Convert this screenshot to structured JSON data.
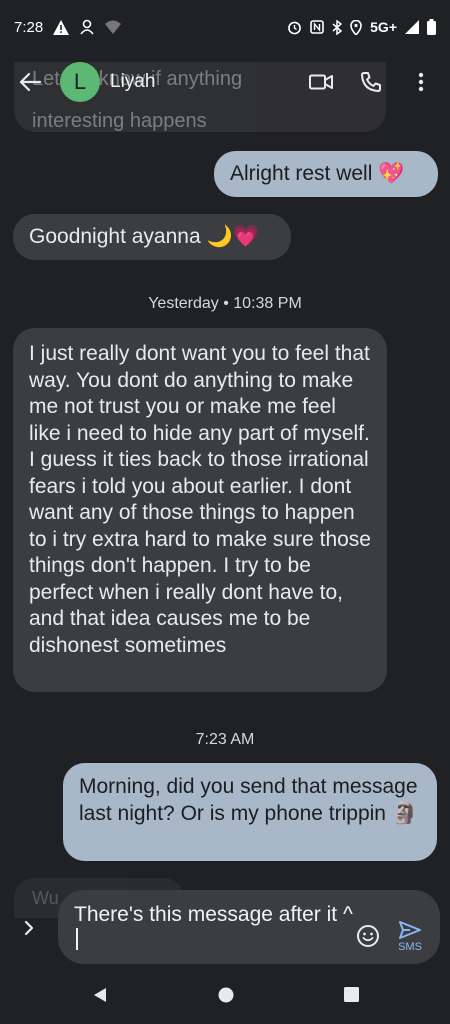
{
  "status_bar": {
    "time": "7:28",
    "network": "5G+"
  },
  "header": {
    "avatar_letter": "L",
    "contact_name": "Liyah"
  },
  "messages": {
    "ghost_top_line1": "Let me know if anything",
    "ghost_top_line2": "interesting happens",
    "m1": "Alright rest well 💖",
    "m2": "Goodnight ayanna 🌙💗",
    "ts1": "Yesterday • 10:38 PM",
    "m3": "I just really dont want you to feel that way. You dont do anything to make me not trust you or make me feel like i need to hide any part of myself. I guess it ties back to those irrational fears i told you about earlier. I dont want any of those things to happen to i try extra hard to make sure those things don't happen. I try to be perfect when i really dont have to, and that idea causes me to be dishonest sometimes",
    "ts2": "7:23 AM",
    "m4": "Morning, did you send that message last night? Or is my phone trippin 🗿",
    "ghost_bottom": "Wu"
  },
  "compose": {
    "text": "There's this message after it ^",
    "send_label": "SMS"
  },
  "colors": {
    "background": "#1f2124",
    "sent_bubble": "#a8b8c9",
    "received_bubble": "#3c3d40",
    "accent": "#8ab4f8",
    "avatar": "#5bb974"
  }
}
